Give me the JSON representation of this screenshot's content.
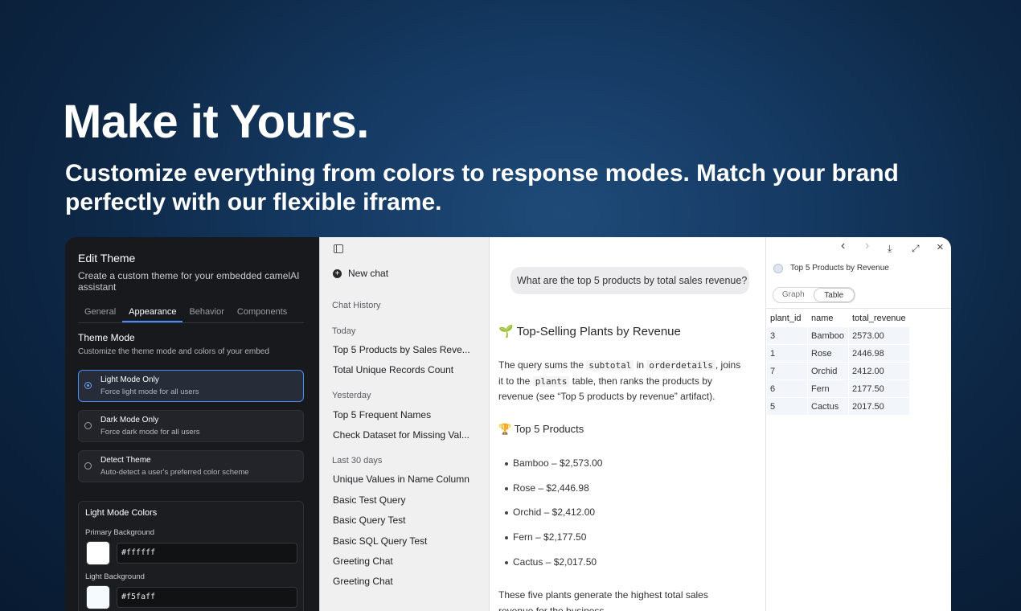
{
  "hero": {
    "title": "Make it Yours.",
    "subtitle": "Customize everything from colors to response modes. Match your brand perfectly with our flexible iframe."
  },
  "theme_panel": {
    "title": "Edit Theme",
    "description": "Create a custom theme for your embedded camelAI assistant",
    "tabs": [
      "General",
      "Appearance",
      "Behavior",
      "Components"
    ],
    "active_tab": "Appearance",
    "section_title": "Theme Mode",
    "section_desc": "Customize the theme mode and colors of your embed",
    "options": [
      {
        "title": "Light Mode Only",
        "desc": "Force light mode for all users",
        "selected": true
      },
      {
        "title": "Dark Mode Only",
        "desc": "Force dark mode for all users",
        "selected": false
      },
      {
        "title": "Detect Theme",
        "desc": "Auto-detect a user's preferred color scheme",
        "selected": false
      }
    ],
    "colors_title": "Light Mode Colors",
    "colors": [
      {
        "label": "Primary Background",
        "value": "#ffffff"
      },
      {
        "label": "Light Background",
        "value": "#f5faff"
      }
    ]
  },
  "sidebar": {
    "new_chat": "New chat",
    "history_label": "Chat History",
    "groups": [
      {
        "label": "Today",
        "items": [
          "Top 5 Products by Sales Reve...",
          "Total Unique Records Count"
        ]
      },
      {
        "label": "Yesterday",
        "items": [
          "Top 5 Frequent Names",
          "Check Dataset for Missing Val..."
        ]
      },
      {
        "label": "Last 30 days",
        "items": [
          "Unique Values in Name Column",
          "Basic Test Query",
          "Basic Query Test",
          "Basic SQL Query Test",
          "Greeting Chat",
          "Greeting Chat"
        ]
      }
    ]
  },
  "chat": {
    "user_message": "What are the top 5 products by total sales revenue?",
    "heading": "🌱 Top-Selling Plants by Revenue",
    "para1_a": "The query sums the ",
    "code1": "subtotal",
    "para1_b": " in ",
    "code2": "orderdetails",
    "para1_c": ", joins",
    "para2_a": "it to the ",
    "code3": "plants",
    "para2_b": " table, then ranks the products by",
    "para3": "revenue (see “Top 5 products by revenue” artifact).",
    "subheading": "🏆 Top 5 Products",
    "list": [
      "Bamboo – $2,573.00",
      "Rose – $2,446.98",
      "Orchid – $2,412.00",
      "Fern – $2,177.50",
      "Cactus – $2,017.50"
    ],
    "footer_l1": "These five plants generate the highest total sales",
    "footer_l2": "revenue for the business."
  },
  "artifact": {
    "title": "Top 5 Products by Revenue",
    "view_options": [
      "Graph",
      "Table"
    ],
    "active_view": "Table",
    "columns": [
      "plant_id",
      "name",
      "total_revenue"
    ],
    "rows": [
      [
        "3",
        "Bamboo",
        "2573.00"
      ],
      [
        "1",
        "Rose",
        "2446.98"
      ],
      [
        "7",
        "Orchid",
        "2412.00"
      ],
      [
        "6",
        "Fern",
        "2177.50"
      ],
      [
        "5",
        "Cactus",
        "2017.50"
      ]
    ],
    "toolbar": {
      "back": "‹",
      "forward": "›",
      "download": "⤓",
      "expand": "⤢",
      "close": "×"
    }
  }
}
